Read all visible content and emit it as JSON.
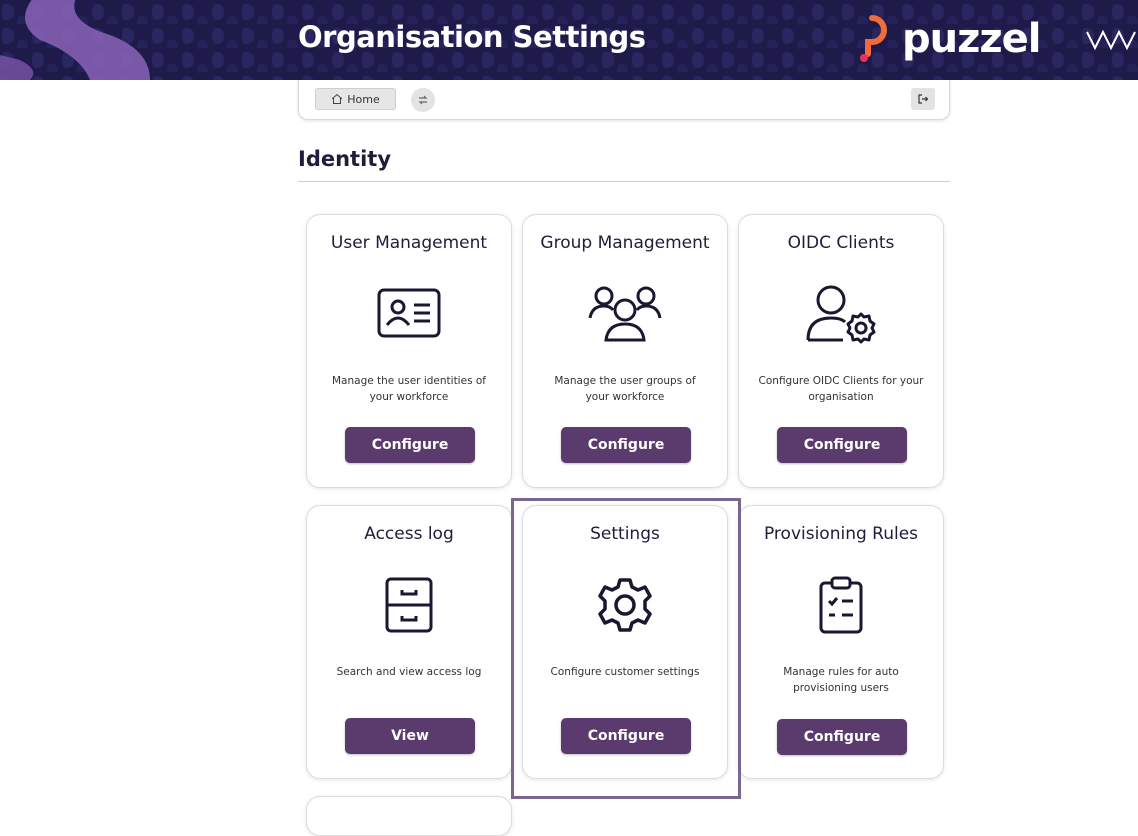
{
  "header": {
    "title": "Organisation Settings",
    "brand": "puzzel",
    "colors": {
      "banner": "#1e1b4b",
      "brand_accent": "#f26b3a",
      "button": "#5b3a6e",
      "highlight": "#7a6691"
    }
  },
  "nav": {
    "home_label": "Home",
    "icons": [
      "home-icon",
      "swap-icon",
      "logout-icon"
    ]
  },
  "section": {
    "title": "Identity"
  },
  "cards": [
    {
      "title": "User Management",
      "desc": "Manage the user identities of your workforce",
      "button": "Configure",
      "icon": "id-card-icon"
    },
    {
      "title": "Group Management",
      "desc": "Manage the user groups of your workforce",
      "button": "Configure",
      "icon": "users-group-icon"
    },
    {
      "title": "OIDC Clients",
      "desc": "Configure OIDC Clients for your organisation",
      "button": "Configure",
      "icon": "user-settings-icon"
    },
    {
      "title": "Access log",
      "desc": "Search and view access log",
      "button": "View",
      "icon": "file-cabinet-icon"
    },
    {
      "title": "Settings",
      "desc": "Configure customer settings",
      "button": "Configure",
      "icon": "gear-icon"
    },
    {
      "title": "Provisioning Rules",
      "desc": "Manage rules for auto provisioning users",
      "button": "Configure",
      "icon": "clipboard-checklist-icon"
    }
  ]
}
